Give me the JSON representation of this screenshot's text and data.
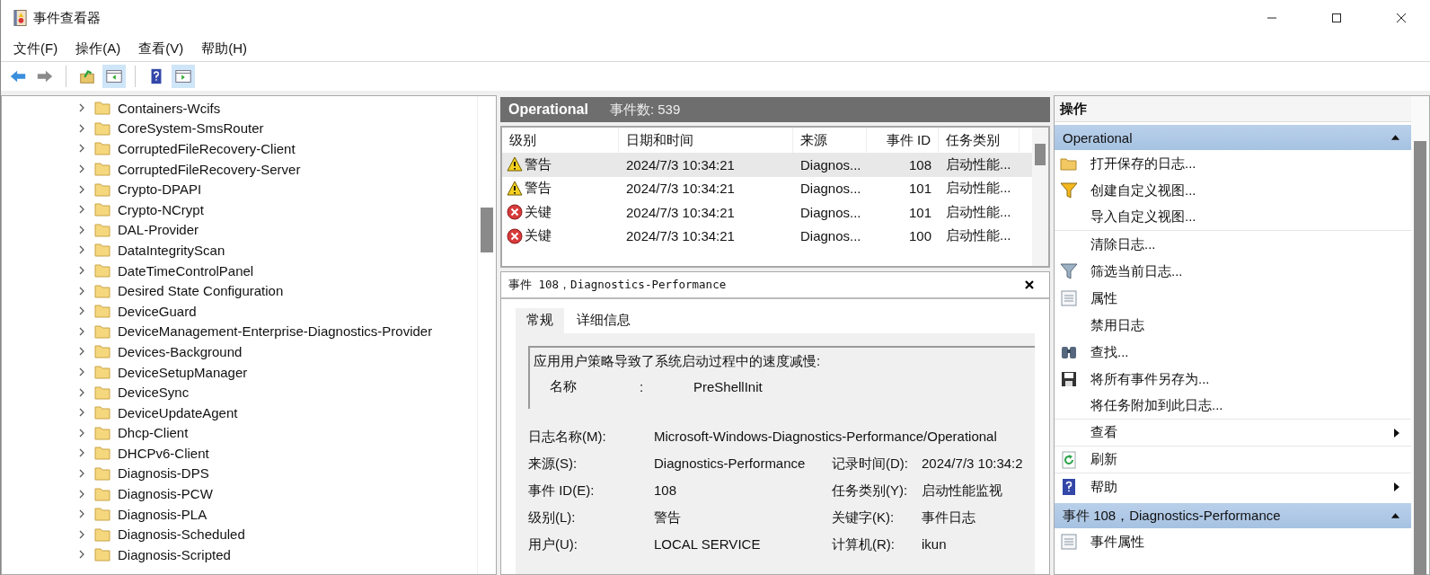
{
  "window": {
    "title": "事件查看器"
  },
  "menu": [
    "文件(F)",
    "操作(A)",
    "查看(V)",
    "帮助(H)"
  ],
  "toolbar": [
    {
      "kind": "back",
      "on": false,
      "disabled": false
    },
    {
      "kind": "forward",
      "on": false,
      "disabled": true
    },
    {
      "kind": "up",
      "on": false,
      "disabled": false
    },
    {
      "kind": "tree-pane",
      "on": true,
      "disabled": false
    },
    {
      "kind": "help",
      "on": false,
      "disabled": false
    },
    {
      "kind": "action-pane",
      "on": true,
      "disabled": false
    }
  ],
  "tree": [
    {
      "label": "Containers-Wcifs",
      "expanded": false
    },
    {
      "label": "CoreSystem-SmsRouter",
      "expanded": false
    },
    {
      "label": "CorruptedFileRecovery-Client",
      "expanded": false
    },
    {
      "label": "CorruptedFileRecovery-Server",
      "expanded": false
    },
    {
      "label": "Crypto-DPAPI",
      "expanded": false
    },
    {
      "label": "Crypto-NCrypt",
      "expanded": false
    },
    {
      "label": "DAL-Provider",
      "expanded": false
    },
    {
      "label": "DataIntegrityScan",
      "expanded": false
    },
    {
      "label": "DateTimeControlPanel",
      "expanded": false
    },
    {
      "label": "Desired State Configuration",
      "expanded": false
    },
    {
      "label": "DeviceGuard",
      "expanded": false
    },
    {
      "label": "DeviceManagement-Enterprise-Diagnostics-Provider",
      "expanded": false
    },
    {
      "label": "Devices-Background",
      "expanded": false
    },
    {
      "label": "DeviceSetupManager",
      "expanded": false
    },
    {
      "label": "DeviceSync",
      "expanded": false
    },
    {
      "label": "DeviceUpdateAgent",
      "expanded": false
    },
    {
      "label": "Dhcp-Client",
      "expanded": false
    },
    {
      "label": "DHCPv6-Client",
      "expanded": false
    },
    {
      "label": "Diagnosis-DPS",
      "expanded": false
    },
    {
      "label": "Diagnosis-PCW",
      "expanded": false
    },
    {
      "label": "Diagnosis-PLA",
      "expanded": false
    },
    {
      "label": "Diagnosis-Scheduled",
      "expanded": false
    },
    {
      "label": "Diagnosis-Scripted",
      "expanded": false
    }
  ],
  "log_header": {
    "name": "Operational",
    "count": "事件数: 539"
  },
  "table": {
    "columns": [
      "级别",
      "日期和时间",
      "来源",
      "事件 ID",
      "任务类别"
    ],
    "rows": [
      {
        "kind": "warning",
        "selected": true,
        "cells": [
          "警告",
          "2024/7/3 10:34:21",
          "Diagnos...",
          "108",
          "启动性能..."
        ]
      },
      {
        "kind": "warning",
        "selected": false,
        "cells": [
          "警告",
          "2024/7/3 10:34:21",
          "Diagnos...",
          "101",
          "启动性能..."
        ]
      },
      {
        "kind": "error",
        "selected": false,
        "cells": [
          "关键",
          "2024/7/3 10:34:21",
          "Diagnos...",
          "101",
          "启动性能..."
        ]
      },
      {
        "kind": "error",
        "selected": false,
        "cells": [
          "关键",
          "2024/7/3 10:34:21",
          "Diagnos...",
          "100",
          "启动性能..."
        ]
      }
    ]
  },
  "detail": {
    "title": "事件 108，Diagnostics-Performance",
    "tabs": [
      {
        "label": "常规",
        "selected": true
      },
      {
        "label": "详细信息",
        "selected": false
      }
    ],
    "description": {
      "text": "应用用户策略导致了系统启动过程中的速度减慢:",
      "rows": [
        {
          "name": "名称",
          "sep": ":",
          "value": "PreShellInit"
        }
      ]
    },
    "log_name": {
      "label": "日志名称(M):",
      "value": "Microsoft-Windows-Diagnostics-Performance/Operational"
    },
    "fields": [
      {
        "label": "来源(S):",
        "value": "Diagnostics-Performance",
        "label2": "记录时间(D):",
        "value2": "2024/7/3 10:34:2"
      },
      {
        "label": "事件 ID(E):",
        "value": "108",
        "label2": "任务类别(Y):",
        "value2": "启动性能监视"
      },
      {
        "label": "级别(L):",
        "value": "警告",
        "label2": "关键字(K):",
        "value2": "事件日志"
      },
      {
        "label": "用户(U):",
        "value": "LOCAL SERVICE",
        "label2": "计算机(R):",
        "value2": "ikun"
      }
    ]
  },
  "actions": {
    "title": "操作",
    "sections": [
      {
        "title": "Operational",
        "expanded": true,
        "items": [
          {
            "label": "打开保存的日志...",
            "kind": "folder",
            "submenu": false,
            "separator": false
          },
          {
            "label": "创建自定义视图...",
            "kind": "funnel",
            "submenu": false,
            "separator": false
          },
          {
            "label": "导入自定义视图...",
            "kind": "plain",
            "submenu": false,
            "separator": true
          },
          {
            "label": "清除日志...",
            "kind": "plain",
            "submenu": false,
            "separator": false
          },
          {
            "label": "筛选当前日志...",
            "kind": "filter",
            "submenu": false,
            "separator": false
          },
          {
            "label": "属性",
            "kind": "properties",
            "submenu": false,
            "separator": false
          },
          {
            "label": "禁用日志",
            "kind": "plain",
            "submenu": false,
            "separator": false
          },
          {
            "label": "查找...",
            "kind": "find",
            "submenu": false,
            "separator": false
          },
          {
            "label": "将所有事件另存为...",
            "kind": "save",
            "submenu": false,
            "separator": false
          },
          {
            "label": "将任务附加到此日志...",
            "kind": "plain",
            "submenu": false,
            "separator": true
          },
          {
            "label": "查看",
            "kind": "plain",
            "submenu": true,
            "separator": true
          },
          {
            "label": "刷新",
            "kind": "refresh",
            "submenu": false,
            "separator": true
          },
          {
            "label": "帮助",
            "kind": "help",
            "submenu": true,
            "separator": false
          }
        ]
      },
      {
        "title": "事件 108，Diagnostics-Performance",
        "expanded": true,
        "items": [
          {
            "label": "事件属性",
            "kind": "properties",
            "submenu": false,
            "separator": false
          }
        ]
      }
    ]
  }
}
